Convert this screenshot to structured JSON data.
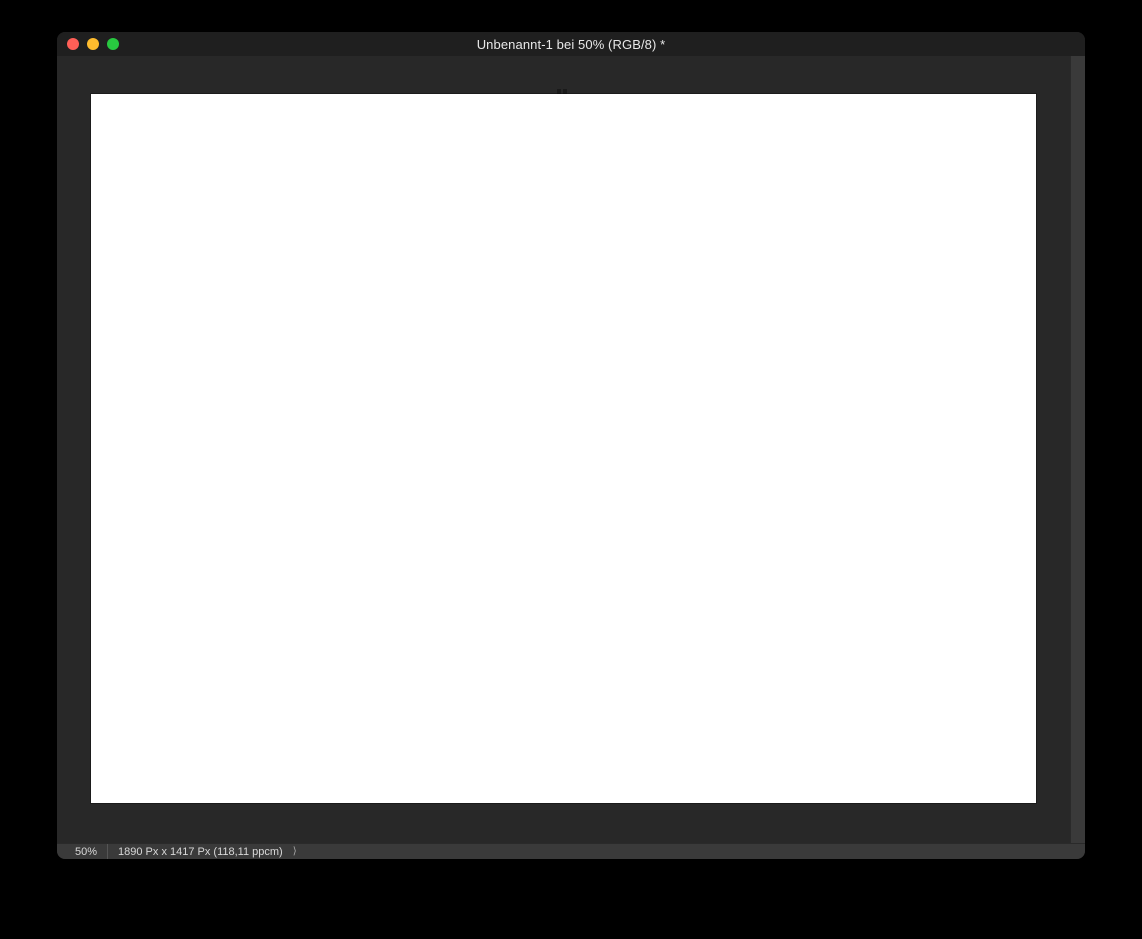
{
  "window": {
    "title": "Unbenannt-1 bei 50% (RGB/8) *"
  },
  "statusbar": {
    "zoom": "50%",
    "dimensions": "1890 Px x 1417 Px (118,11 ppcm)",
    "chevron": "⟩"
  }
}
